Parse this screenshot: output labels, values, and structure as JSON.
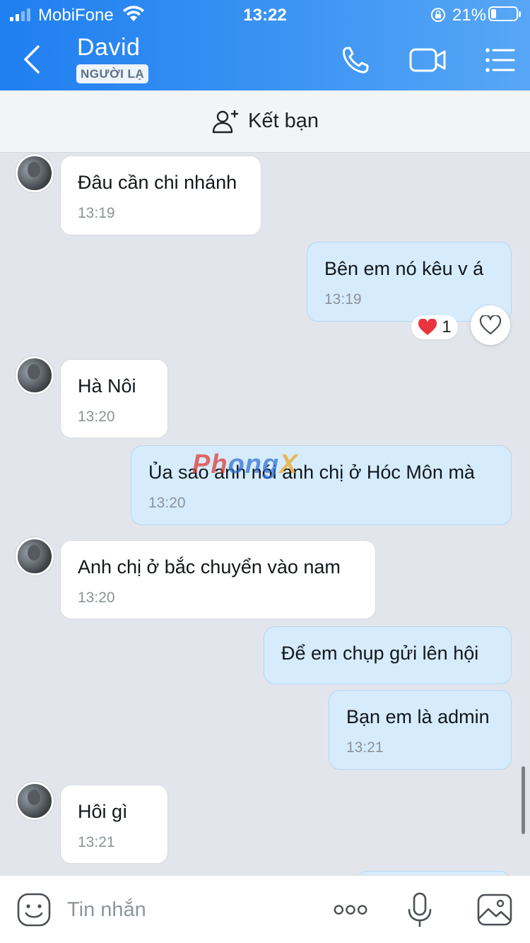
{
  "status_bar": {
    "carrier": "MobiFone",
    "time": "13:22",
    "battery_percent": "21%",
    "battery_level": 0.21,
    "signal_bars_filled": 2,
    "icons": [
      "signal-icon",
      "wifi-icon",
      "orientation-lock-icon",
      "battery-icon"
    ]
  },
  "header": {
    "contact_name": "David",
    "badge": "NGƯỜI LẠ",
    "icons": [
      "back-icon",
      "phone-icon",
      "video-call-icon",
      "menu-icon"
    ]
  },
  "friend_bar": {
    "label": "Kết bạn",
    "icon": "add-friend-icon"
  },
  "messages": [
    {
      "side": "in",
      "text": "Đâu cần chi nhánh",
      "time": "13:19"
    },
    {
      "side": "out",
      "text": "Bên em nó kêu v á",
      "time": "13:19",
      "reaction": {
        "emoji": "❤️",
        "count": "1"
      }
    },
    {
      "side": "in",
      "text": "Hà Nôi",
      "time": "13:20"
    },
    {
      "side": "out",
      "text": "Ủa sao anh nói anh chị ở Hóc Môn mà",
      "time": "13:20"
    },
    {
      "side": "in",
      "text": "Anh chị ở bắc chuyển  vào nam",
      "time": "13:20"
    },
    {
      "side": "out",
      "text": "Để em chụp gửi lên hội",
      "time": ""
    },
    {
      "side": "out",
      "text": "Bạn em là admin",
      "time": "13:21"
    },
    {
      "side": "in",
      "text": "Hôi gì",
      "time": "13:21"
    }
  ],
  "watermark": {
    "part1": "Ph",
    "part2": "ong",
    "part3": "X"
  },
  "input_bar": {
    "placeholder": "Tin nhắn",
    "icons": [
      "sticker-icon",
      "more-icon",
      "microphone-icon",
      "image-icon"
    ]
  },
  "colors": {
    "header_gradient_start": "#1f7ff0",
    "header_gradient_end": "#58a7f6",
    "chat_background": "#e2e6ec",
    "incoming_bubble": "#ffffff",
    "outgoing_bubble": "#d6ecfc",
    "reaction_heart": "#e8343f"
  }
}
